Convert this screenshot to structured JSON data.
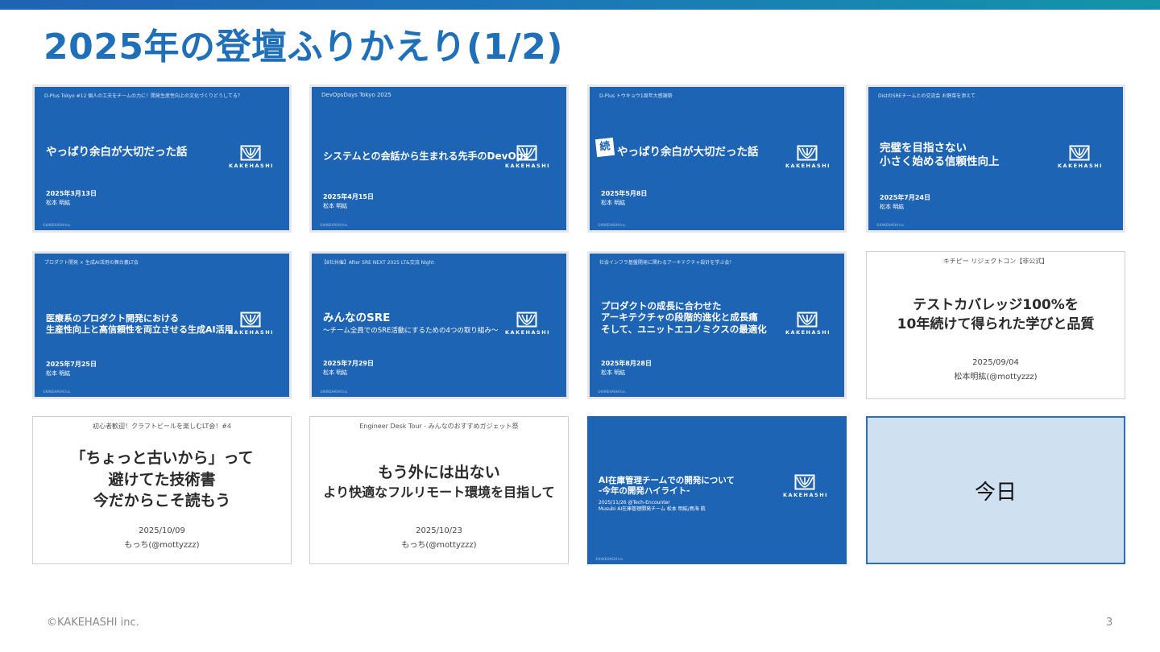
{
  "title": "2025年の登壇ふりかえり(1/2)",
  "logo_text": "KAKEHASHI",
  "slide_copyright": "©KAKEHASHI Inc.",
  "slides": [
    {
      "event": "D-Plus Tokyo #12 個人の工夫をチームの力に！開発生産性向上の文化づくりどうしてる？",
      "title": "やっぱり余白が大切だった話",
      "date": "2025年3月13日",
      "author": "松本 明紘"
    },
    {
      "event": "DevOpsDays Tokyo 2025",
      "title": "システムとの会話から生まれる先手のDevOps",
      "date": "2025年4月15日",
      "author": "松本 明紘"
    },
    {
      "event": "D-Plus トウキョウ1周年大感謝祭",
      "tag": "続",
      "title": "やっぱり余白が大切だった話",
      "date": "2025年5月8日",
      "author": "松本 明紘"
    },
    {
      "event": "DistのSREチームとの交流会 お野菜を添えて",
      "title_lines": [
        "完璧を目指さない",
        "小さく始める信頼性向上"
      ],
      "date": "2025年7月24日",
      "author": "松本 明紘"
    },
    {
      "event": "プロダクト開発 × 生成AI活用の舞台裏LT会",
      "title_lines": [
        "医療系のプロダクト開発における",
        "生産性向上と高信頼性を両立させる生成AI活用"
      ],
      "date": "2025年7月25日",
      "author": "松本 明紘"
    },
    {
      "event": "【8社共催】After SRE NEXT 2025 LT&交流 Night",
      "title": "みんなのSRE",
      "subtitle": "〜チーム全員でのSRE活動にするための4つの取り組み〜",
      "date": "2025年7月29日",
      "author": "松本 明紘"
    },
    {
      "event": "社会インフラ基盤開発に関わるアーキテクチャ設計を学ぶ会！",
      "title_lines": [
        "プロダクトの成長に合わせた",
        "アーキテクチャの段階的進化と成長痛",
        "そして、ユニットエコノミクスの最適化"
      ],
      "date": "2025年8月28日",
      "author": "松本 明紘"
    },
    {
      "event": "キチピー リジェクトコン【非公式】",
      "title_lines": [
        "テストカバレッジ100%を",
        "10年続けて得られた学びと品質"
      ],
      "date": "2025/09/04",
      "author": "松本明紘(@mottyzzz)"
    },
    {
      "event": "初心者歓迎！クラフトビールを楽しむLT会！#4",
      "title_lines": [
        "「ちょっと古いから」って",
        "避けてた技術書",
        "今だからこそ読もう"
      ],
      "date": "2025/10/09",
      "author": "もっち(@mottyzzz)"
    },
    {
      "event": "Engineer Desk Tour - みんなのおすすめガジェット祭",
      "title_lines": [
        "もう外には出ない",
        "より快適なフルリモート環境を目指して"
      ],
      "date": "2025/10/23",
      "author": "もっち(@mottyzzz)"
    },
    {
      "title_lines": [
        "AI在庫管理チームでの開発について",
        "-今年の開発ハイライト-"
      ],
      "detail_lines": [
        "2025/11/26 @Tech-Encounter",
        "Musubi AI在庫管理開発チーム 松本 明紘/鳥海 航"
      ]
    },
    {
      "label": "今日"
    }
  ],
  "footer": {
    "copyright": "©KAKEHASHI inc.",
    "page_number": "3"
  },
  "colors": {
    "title": "#1f70b8",
    "slide_blue": "#1e64b4",
    "today_fill": "#cfe1f1",
    "today_border": "#2d6fb6"
  }
}
